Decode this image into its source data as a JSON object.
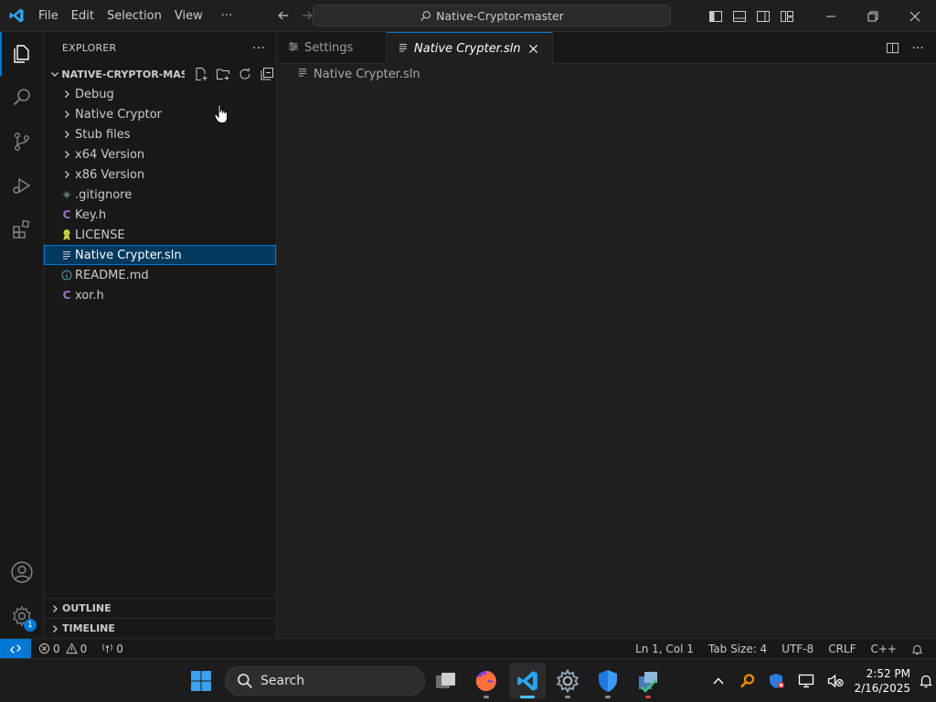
{
  "titlebar": {
    "menus": [
      "File",
      "Edit",
      "Selection",
      "View"
    ],
    "more": "···",
    "command_center": "Native-Cryptor-master"
  },
  "activitybar": {
    "items": [
      "explorer-icon",
      "search-icon",
      "source-control-icon",
      "run-debug-icon",
      "extensions-icon"
    ],
    "manage_badge": "1"
  },
  "sidebar": {
    "title": "EXPLORER",
    "more": "···",
    "folder": "NATIVE-CRYPTOR-MAST...",
    "tree": [
      {
        "label": "Debug",
        "type": "folder"
      },
      {
        "label": "Native Cryptor",
        "type": "folder"
      },
      {
        "label": "Stub files",
        "type": "folder"
      },
      {
        "label": "x64 Version",
        "type": "folder"
      },
      {
        "label": "x86 Version",
        "type": "folder"
      },
      {
        "label": ".gitignore",
        "type": "git"
      },
      {
        "label": "Key.h",
        "type": "c"
      },
      {
        "label": "LICENSE",
        "type": "license"
      },
      {
        "label": "Native Crypter.sln",
        "type": "sln",
        "selected": true
      },
      {
        "label": "README.md",
        "type": "info"
      },
      {
        "label": "xor.h",
        "type": "c"
      }
    ],
    "sections": {
      "outline": "OUTLINE",
      "timeline": "TIMELINE"
    }
  },
  "editor": {
    "tabs": [
      {
        "label": "Settings",
        "active": false
      },
      {
        "label": "Native Crypter.sln",
        "active": true
      }
    ],
    "breadcrumb": "Native Crypter.sln"
  },
  "statusbar": {
    "errors": "0",
    "warnings": "0",
    "ports": "0",
    "position": "Ln 1, Col 1",
    "tab_size": "Tab Size: 4",
    "encoding": "UTF-8",
    "eol": "CRLF",
    "language": "C++"
  },
  "taskbar": {
    "search_label": "Search",
    "time": "2:52 PM",
    "date": "2/16/2025"
  },
  "colors": {
    "accent": "#0078d4",
    "c_icon": "#a074c4",
    "license_icon": "#cbcb41",
    "selection": "#04395e"
  }
}
